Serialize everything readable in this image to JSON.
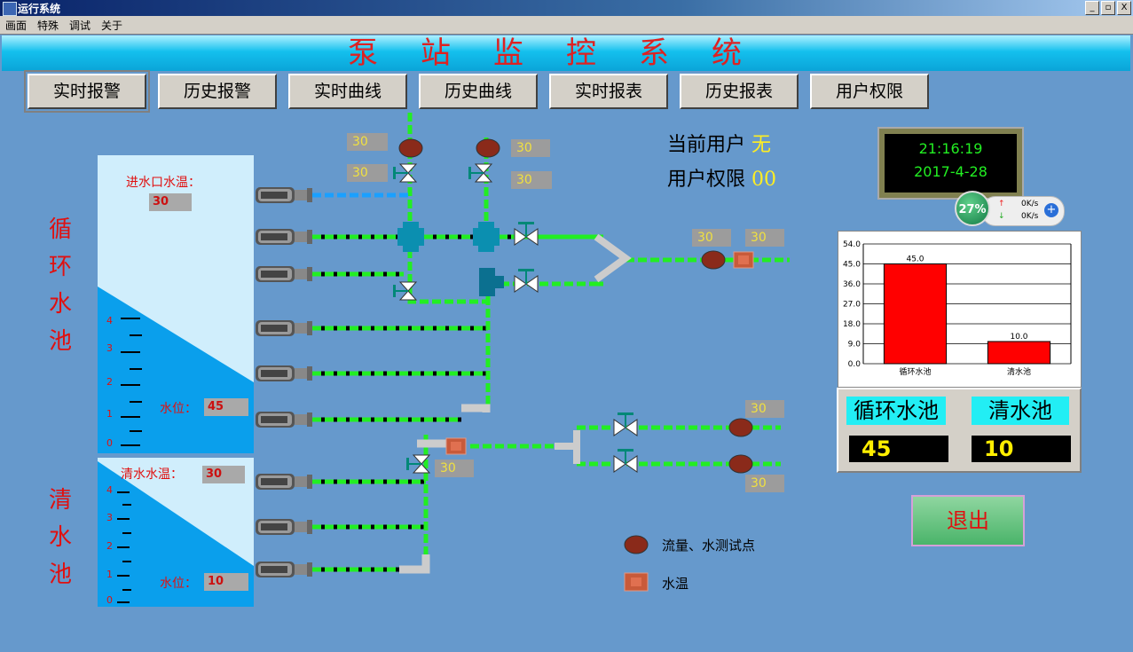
{
  "window": {
    "title": "运行系统",
    "buttons": [
      "_",
      "▫",
      "X"
    ]
  },
  "menu": [
    "画面",
    "特殊",
    "调试",
    "关于"
  ],
  "banner_title": "泵站监控系统",
  "nav": [
    {
      "label": "实时报警",
      "selected": true
    },
    {
      "label": "历史报警"
    },
    {
      "label": "实时曲线"
    },
    {
      "label": "历史曲线"
    },
    {
      "label": "实时报表"
    },
    {
      "label": "历史报表"
    },
    {
      "label": "用户权限"
    }
  ],
  "circ_tank": {
    "name": "循环水池",
    "side_chars": [
      "循",
      "环",
      "水",
      "池"
    ],
    "temp_label": "进水口水温：",
    "temp_value": "30",
    "level_label": "水位：",
    "level_value": "45",
    "fill_ratio": 0.75,
    "scale": [
      "4",
      "3",
      "2",
      "1",
      "0"
    ]
  },
  "clean_tank": {
    "name": "清水池",
    "side_chars": [
      "清",
      "水",
      "池"
    ],
    "temp_label": "清水水温：",
    "temp_value": "30",
    "level_label": "水位：",
    "level_value": "10",
    "fill_ratio": 0.3,
    "scale": [
      "4",
      "3",
      "2",
      "1",
      "0"
    ]
  },
  "sensor_values": [
    "30",
    "30",
    "30",
    "30",
    "30",
    "30",
    "30",
    "30",
    "30",
    "30"
  ],
  "user": {
    "current_label": "当前用户",
    "current_value": "无",
    "perm_label": "用户权限",
    "perm_value": "00"
  },
  "clock": {
    "time": "21:16:19",
    "date": "2017-4-28"
  },
  "network": {
    "percent": "27%",
    "up": "0K/s",
    "down": "0K/s"
  },
  "chart_data": {
    "type": "bar",
    "categories": [
      "循环水池",
      "清水池"
    ],
    "values": [
      45.0,
      10.0
    ],
    "yticks": [
      "54.0",
      "45.0",
      "36.0",
      "27.0",
      "18.0",
      "9.0",
      "0.0"
    ],
    "ylim": [
      0,
      54
    ],
    "colors": [
      "#ff0000",
      "#ff0000"
    ],
    "grid": true
  },
  "panel": {
    "circ_title": "循环水池",
    "circ_value": "45",
    "clean_title": "清水池",
    "clean_value": "10"
  },
  "exit_label": "退出",
  "legend": {
    "flow_label": "流量、水测试点",
    "temp_label": "水温"
  },
  "colors": {
    "pipe": "#22ee22",
    "banner_title": "#dd2222",
    "bar": "#ff0000"
  }
}
